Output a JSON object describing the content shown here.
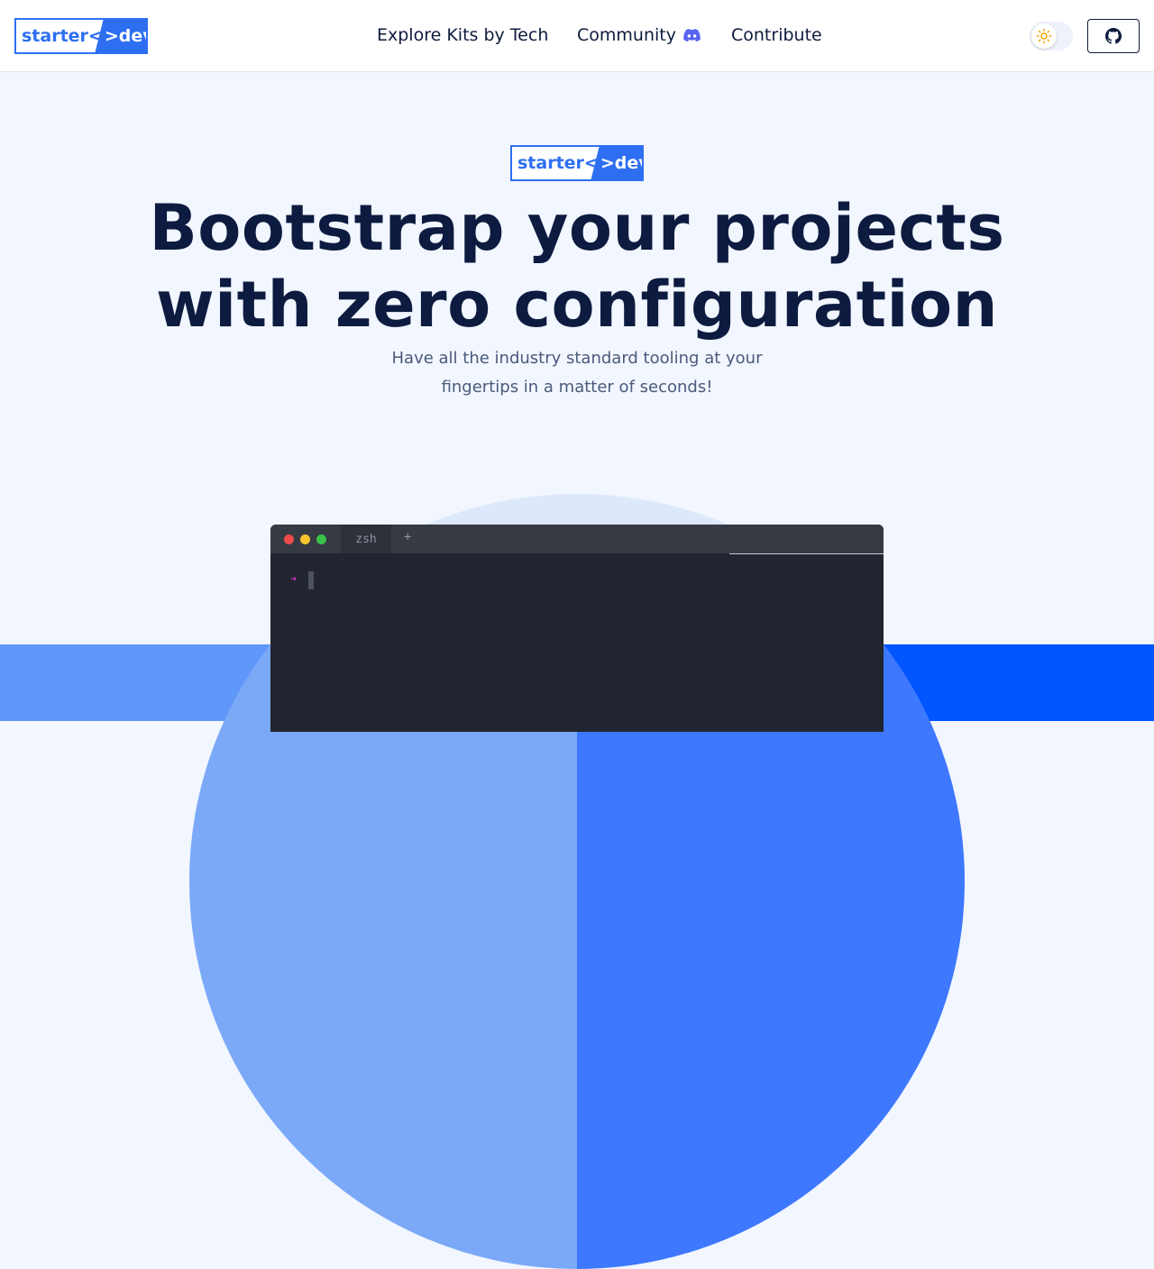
{
  "header": {
    "logo": {
      "left": "starter<",
      "right": ">dev"
    },
    "nav": [
      {
        "label": "Explore Kits by Tech"
      },
      {
        "label": "Community"
      },
      {
        "label": "Contribute"
      }
    ],
    "theme_toggle_icon": "sun-icon",
    "github_icon": "github-icon"
  },
  "hero": {
    "logo": {
      "left": "starter<",
      "right": ">dev"
    },
    "title_line1": "Bootstrap your projects",
    "title_line2": "with zero configuration",
    "subtitle_line1": "Have all the industry standard tooling at your",
    "subtitle_line2": "fingertips in a matter of seconds!"
  },
  "terminal": {
    "tab_label": "zsh",
    "new_tab": "+",
    "prompt_symbol": "➔"
  },
  "colors": {
    "brand_blue": "#2e6ff2",
    "discord": "#5865f2",
    "terminal_bg": "#21252f"
  }
}
